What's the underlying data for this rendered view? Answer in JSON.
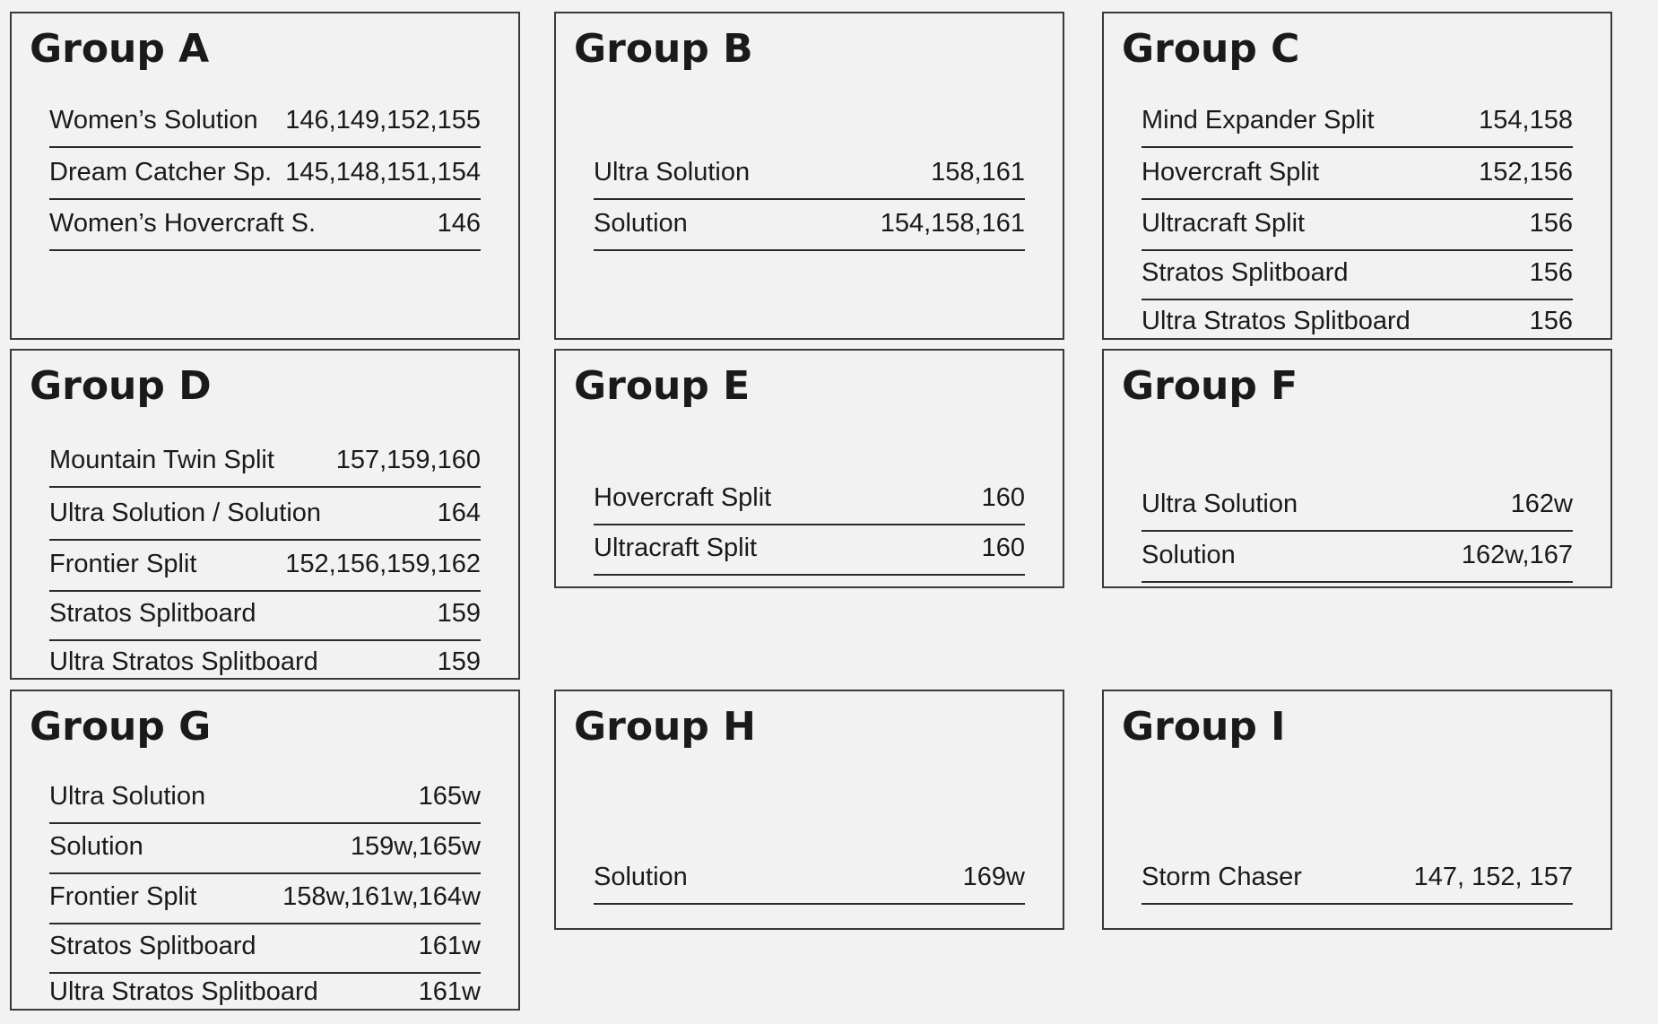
{
  "groups": [
    {
      "title": "Group A",
      "rows": [
        {
          "name": "Women’s Solution",
          "sizes": "146,149,152,155"
        },
        {
          "name": "Dream Catcher Sp.",
          "sizes": "145,148,151,154"
        },
        {
          "name": "Women’s Hovercraft S.",
          "sizes": "146"
        }
      ]
    },
    {
      "title": "Group B",
      "rows": [
        {
          "name": "Ultra Solution",
          "sizes": "158,161"
        },
        {
          "name": "Solution",
          "sizes": "154,158,161"
        }
      ]
    },
    {
      "title": "Group C",
      "rows": [
        {
          "name": "Mind Expander Split",
          "sizes": "154,158"
        },
        {
          "name": "Hovercraft Split",
          "sizes": "152,156"
        },
        {
          "name": "Ultracraft Split",
          "sizes": "156"
        },
        {
          "name": "Stratos Splitboard",
          "sizes": "156"
        },
        {
          "name": "Ultra Stratos Splitboard",
          "sizes": "156"
        }
      ]
    },
    {
      "title": "Group D",
      "rows": [
        {
          "name": "Mountain Twin Split",
          "sizes": "157,159,160"
        },
        {
          "name": "Ultra Solution / Solution",
          "sizes": "164"
        },
        {
          "name": "Frontier Split",
          "sizes": "152,156,159,162"
        },
        {
          "name": "Stratos Splitboard",
          "sizes": "159"
        },
        {
          "name": "Ultra Stratos Splitboard",
          "sizes": "159"
        }
      ]
    },
    {
      "title": "Group E",
      "rows": [
        {
          "name": "Hovercraft Split",
          "sizes": "160"
        },
        {
          "name": "Ultracraft Split",
          "sizes": "160"
        }
      ]
    },
    {
      "title": "Group F",
      "rows": [
        {
          "name": "Ultra Solution",
          "sizes": "162w"
        },
        {
          "name": "Solution",
          "sizes": "162w,167"
        }
      ]
    },
    {
      "title": "Group G",
      "rows": [
        {
          "name": "Ultra Solution",
          "sizes": "165w"
        },
        {
          "name": "Solution",
          "sizes": "159w,165w"
        },
        {
          "name": "Frontier Split",
          "sizes": "158w,161w,164w"
        },
        {
          "name": "Stratos Splitboard",
          "sizes": "161w"
        },
        {
          "name": "Ultra Stratos Splitboard",
          "sizes": "161w"
        }
      ]
    },
    {
      "title": "Group H",
      "rows": [
        {
          "name": "Solution",
          "sizes": "169w"
        }
      ]
    },
    {
      "title": "Group I",
      "rows": [
        {
          "name": "Storm Chaser",
          "sizes": "147, 152, 157"
        }
      ]
    }
  ]
}
